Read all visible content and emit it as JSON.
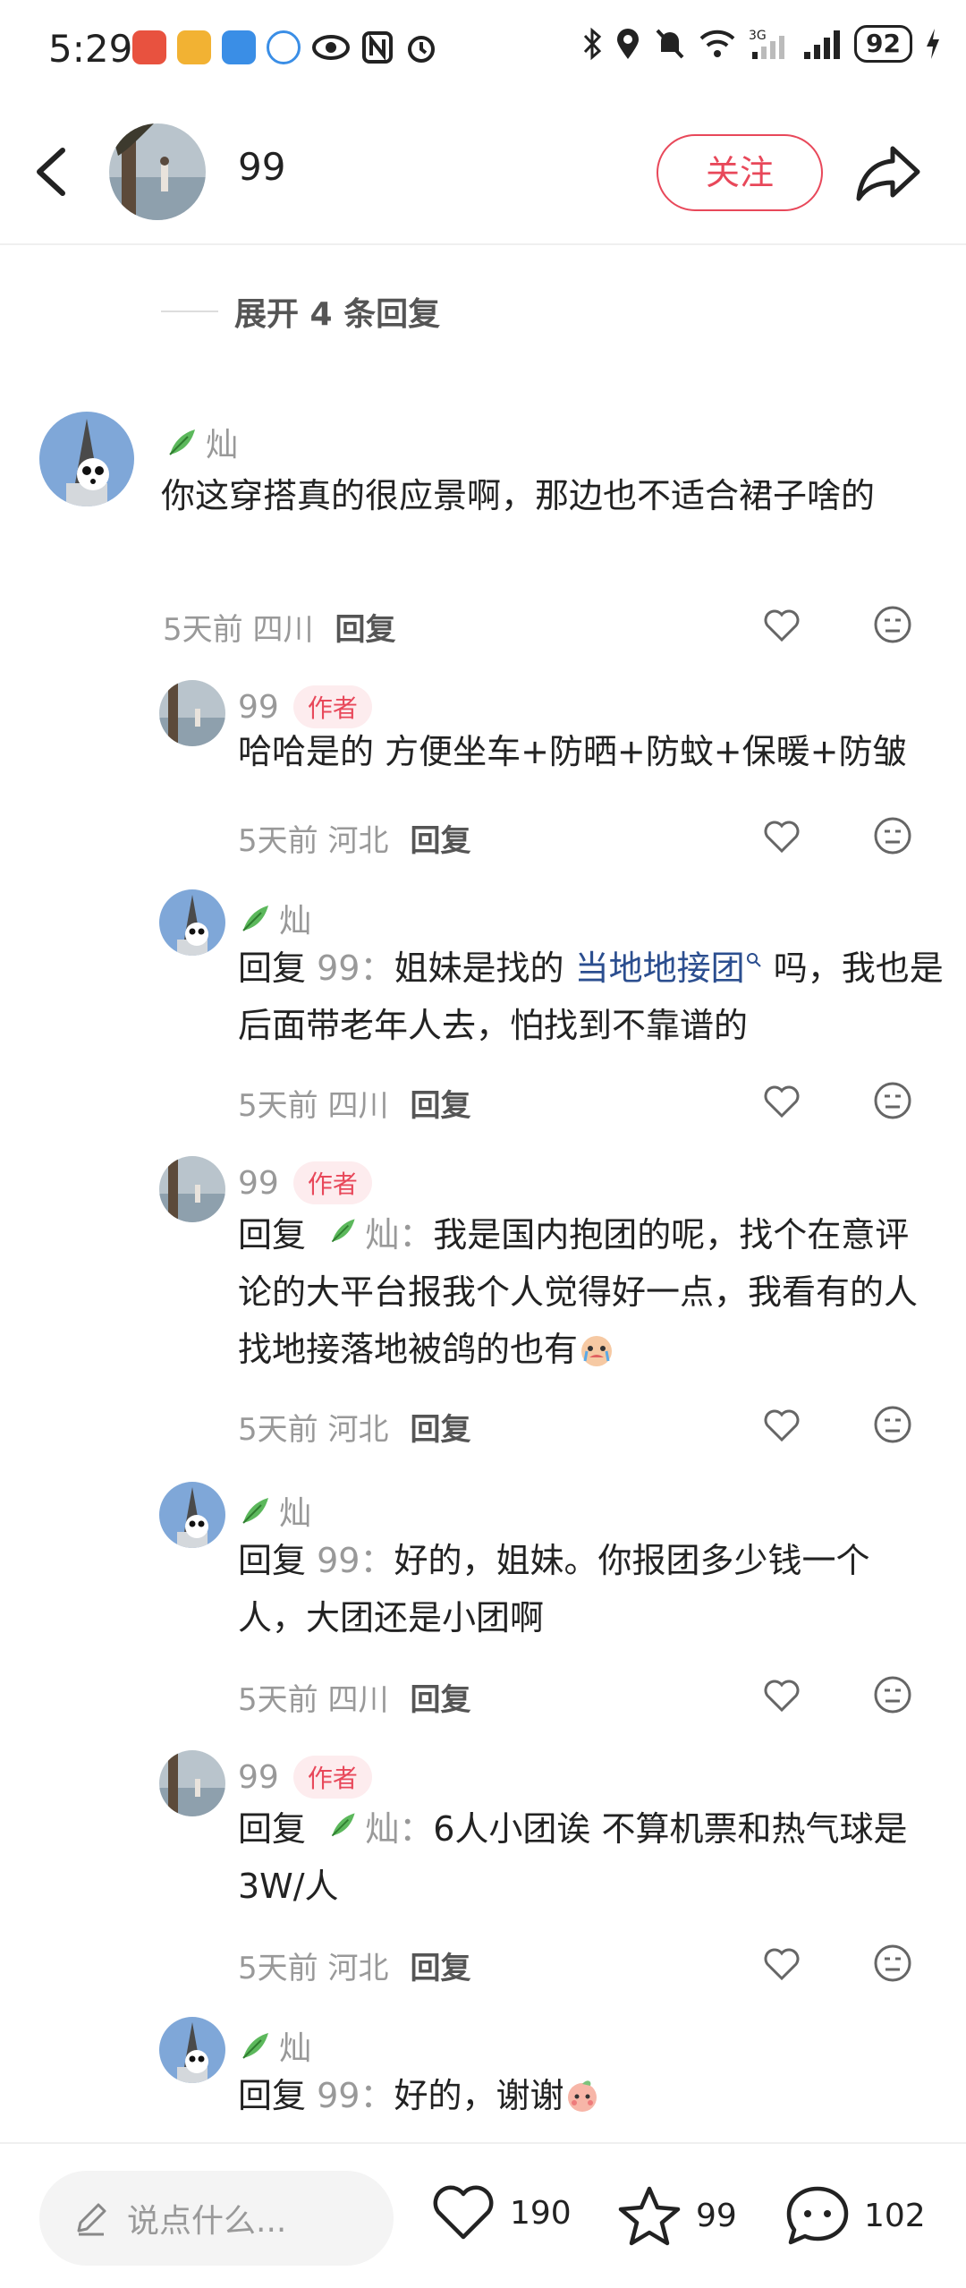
{
  "status_bar": {
    "time": "5:29",
    "battery": "92"
  },
  "header": {
    "username": "99",
    "follow_label": "关注"
  },
  "expand_replies": "展开 4 条回复",
  "comments": [
    {
      "name": "灿",
      "content": "你这穿搭真的很应景啊，那边也不适合裙子啥的",
      "time": "5天前",
      "location": "四川",
      "reply_label": "回复"
    },
    {
      "name": "99",
      "badge": "作者",
      "content": "哈哈是的 方便坐车+防晒+防蚊+保暖+防皱",
      "time": "5天前",
      "location": "河北",
      "reply_label": "回复"
    },
    {
      "name": "灿",
      "reply_prefix": "回复",
      "reply_target": "99：",
      "content_a": "姐妹是找的",
      "link_text": "当地地接团",
      "content_b": "吗，我也是后面带老年人去，怕找到不靠谱的",
      "time": "5天前",
      "location": "四川",
      "reply_label": "回复"
    },
    {
      "name": "99",
      "badge": "作者",
      "reply_prefix": "回复",
      "reply_target": "灿：",
      "content": "我是国内抱团的呢，找个在意评论的大平台报我个人觉得好一点，我看有的人找地接落地被鸽的也有",
      "time": "5天前",
      "location": "河北",
      "reply_label": "回复"
    },
    {
      "name": "灿",
      "reply_prefix": "回复",
      "reply_target": "99：",
      "content": "好的，姐妹。你报团多少钱一个人，大团还是小团啊",
      "time": "5天前",
      "location": "四川",
      "reply_label": "回复"
    },
    {
      "name": "99",
      "badge": "作者",
      "reply_prefix": "回复",
      "reply_target": "灿：",
      "content": "6人小团诶 不算机票和热气球是3W/人",
      "time": "5天前",
      "location": "河北",
      "reply_label": "回复"
    },
    {
      "name": "灿",
      "reply_prefix": "回复",
      "reply_target": "99：",
      "content": "好的，谢谢"
    }
  ],
  "bottom_bar": {
    "placeholder": "说点什么...",
    "likes": "190",
    "favorites": "99",
    "comments": "102"
  },
  "colors": {
    "accent": "#e8485a",
    "link": "#2b4e8f"
  }
}
